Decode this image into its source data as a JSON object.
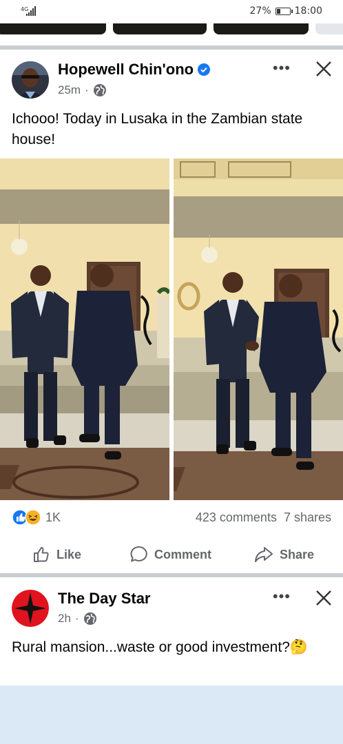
{
  "status_bar": {
    "network": "4G",
    "battery": "27%",
    "battery_level": 0.27,
    "time": "18:00"
  },
  "post1": {
    "author": "Hopewell Chin'ono",
    "verified": true,
    "time": "25m",
    "privacy_icon": "globe-icon",
    "text": "Ichooo! Today in Lusaka in the Zambian state house!",
    "reactions_count": "1K",
    "comments": "423 comments",
    "shares": "7 shares",
    "actions": {
      "like": "Like",
      "comment": "Comment",
      "share": "Share"
    }
  },
  "post2": {
    "author": "The Day Star",
    "time": "2h",
    "privacy_icon": "globe-icon",
    "text": "Rural mansion...waste or good investment?🤔"
  },
  "colors": {
    "facebook_blue": "#1877f2",
    "reaction_yellow": "#f7b125",
    "gray_text": "#65676b",
    "divider": "#c9ccd1"
  }
}
